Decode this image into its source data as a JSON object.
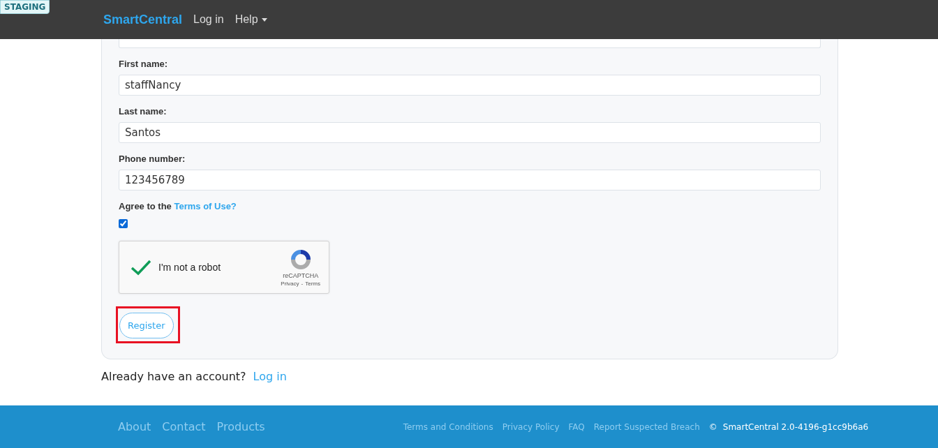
{
  "badge": "STAGING",
  "navbar": {
    "brand": "SmartCentral",
    "links": [
      {
        "label": "Log in",
        "kind": "link"
      },
      {
        "label": "Help",
        "kind": "dropdown"
      }
    ]
  },
  "form": {
    "fields": [
      {
        "label": "First name:",
        "value": "staffNancy"
      },
      {
        "label": "Last name:",
        "value": "Santos"
      },
      {
        "label": "Phone number:",
        "value": "123456789"
      }
    ],
    "terms": {
      "text": "Agree to the ",
      "link": "Terms of Use?",
      "checked": true
    },
    "captcha": {
      "label": "I'm not a robot",
      "checked": true,
      "brand": "reCAPTCHA",
      "privacy": "Privacy",
      "separator": "-",
      "terms": "Terms"
    },
    "submit": {
      "label": "Register",
      "highlighted": true
    }
  },
  "login_prompt": {
    "text": "Already have an account?",
    "link": "Log in"
  },
  "footer": {
    "links": [
      "About",
      "Contact",
      "Products"
    ],
    "legal_links": [
      "Terms and Conditions",
      "Privacy Policy",
      "FAQ",
      "Report Suspected Breach"
    ],
    "copyright": "©",
    "version": "SmartCentral 2.0-4196-g1cc9b6a6"
  }
}
